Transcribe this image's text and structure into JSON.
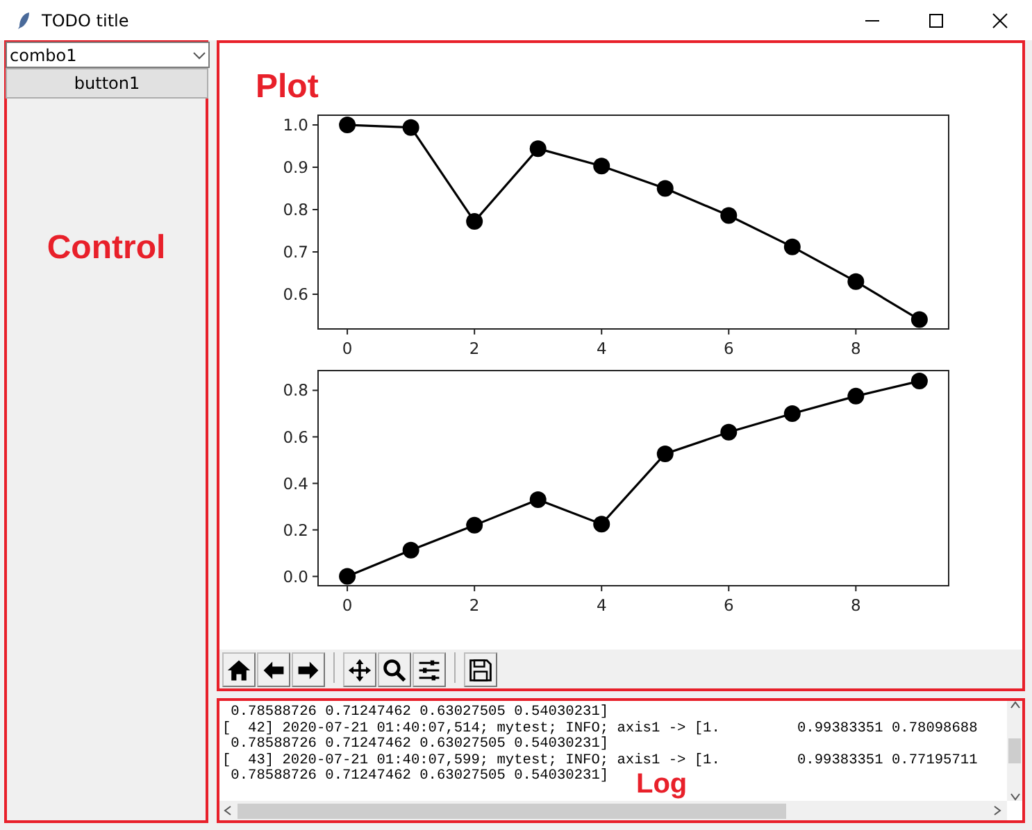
{
  "window": {
    "title": "TODO title"
  },
  "control_panel": {
    "label": "Control",
    "combo": {
      "value": "combo1"
    },
    "button": "button1"
  },
  "plot_panel": {
    "label": "Plot",
    "charts": [
      {
        "chart_data": {
          "type": "line",
          "x": [
            0,
            1,
            2,
            3,
            4,
            5,
            6,
            7,
            8,
            9
          ],
          "series": [
            {
              "color": "#000000",
              "marker": "o",
              "values": [
                1.0,
                0.994,
                0.772,
                0.944,
                0.903,
                0.85,
                0.786,
                0.712,
                0.63,
                0.54
              ]
            }
          ],
          "xlim": [
            -0.46,
            9.46
          ],
          "ylim": [
            0.518,
            1.023
          ],
          "xticks": [
            0,
            2,
            4,
            6,
            8
          ],
          "yticks": [
            {
              "value": 0.6,
              "label": "0.6"
            },
            {
              "value": 0.7,
              "label": "0.7"
            },
            {
              "value": 0.8,
              "label": "0.8"
            },
            {
              "value": 0.9,
              "label": "0.9"
            },
            {
              "value": 1.0,
              "label": "1.0"
            }
          ]
        }
      },
      {
        "chart_data": {
          "type": "line",
          "x": [
            0,
            1,
            2,
            3,
            4,
            5,
            6,
            7,
            8,
            9
          ],
          "series": [
            {
              "color": "#000000",
              "marker": "o",
              "values": [
                0.0,
                0.113,
                0.22,
                0.33,
                0.225,
                0.527,
                0.62,
                0.7,
                0.775,
                0.84
              ]
            }
          ],
          "xlim": [
            -0.46,
            9.46
          ],
          "ylim": [
            -0.04,
            0.885
          ],
          "xticks": [
            0,
            2,
            4,
            6,
            8
          ],
          "yticks": [
            {
              "value": 0,
              "label": "0.0"
            },
            {
              "value": 0.2,
              "label": "0.2"
            },
            {
              "value": 0.4,
              "label": "0.4"
            },
            {
              "value": 0.6,
              "label": "0.6"
            },
            {
              "value": 0.8,
              "label": "0.8"
            }
          ]
        }
      }
    ],
    "toolbar": [
      {
        "kind": "home"
      },
      {
        "kind": "back"
      },
      {
        "kind": "forward"
      },
      {
        "kind": "separator"
      },
      {
        "kind": "pan"
      },
      {
        "kind": "zoom"
      },
      {
        "kind": "configure"
      },
      {
        "kind": "separator"
      },
      {
        "kind": "save"
      }
    ]
  },
  "log_panel": {
    "label": "Log",
    "lines": [
      " 0.78588726 0.71247462 0.63027505 0.54030231]",
      "[  42] 2020-07-21 01:40:07,514; mytest; INFO; axis1 -> [1.         0.99383351 0.78098688",
      " 0.78588726 0.71247462 0.63027505 0.54030231]",
      "[  43] 2020-07-21 01:40:07,599; mytest; INFO; axis1 -> [1.         0.99383351 0.77195711",
      " 0.78588726 0.71247462 0.63027505 0.54030231]"
    ]
  }
}
